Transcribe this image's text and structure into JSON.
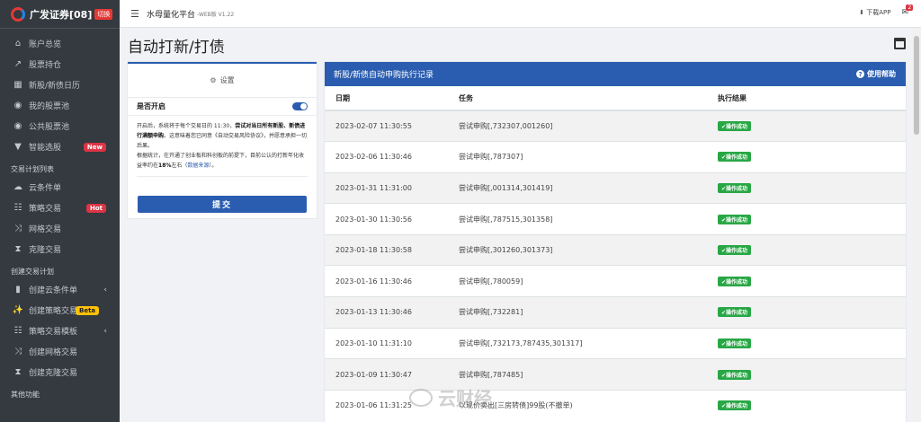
{
  "sidebar": {
    "brand": "广发证券[08]",
    "switch_label": "切换",
    "items_top": [
      {
        "label": "账户总览",
        "icon": "home-icon"
      },
      {
        "label": "股票持仓",
        "icon": "chart-line-icon"
      },
      {
        "label": "新股/新债日历",
        "icon": "calendar-icon"
      },
      {
        "label": "我的股票池",
        "icon": "coins-icon"
      },
      {
        "label": "公共股票池",
        "icon": "coins-icon"
      },
      {
        "label": "智能选股",
        "icon": "filter-icon",
        "tag": "New"
      }
    ],
    "section1": "交易计划列表",
    "items_plan": [
      {
        "label": "云条件单",
        "icon": "cloud-icon"
      },
      {
        "label": "策略交易",
        "icon": "sitemap-icon",
        "tag": "Hot"
      },
      {
        "label": "网格交易",
        "icon": "random-icon"
      },
      {
        "label": "克隆交易",
        "icon": "hourglass-icon"
      }
    ],
    "section2": "创建交易计划",
    "items_create": [
      {
        "label": "创建云条件单",
        "icon": "file-icon"
      },
      {
        "label": "创建策略交易",
        "icon": "magic-icon",
        "tag": "Beta"
      },
      {
        "label": "策略交易模板",
        "icon": "sitemap-icon"
      },
      {
        "label": "创建网格交易",
        "icon": "random-icon"
      },
      {
        "label": "创建克隆交易",
        "icon": "hourglass-icon"
      }
    ],
    "section3": "其他功能"
  },
  "topbar": {
    "title": "水母量化平台",
    "version": "-WEB版 V1.22",
    "download": "下载APP",
    "msg_count": "2"
  },
  "page": {
    "title": "自动打新/打债"
  },
  "settings": {
    "header": "设置",
    "toggle_label": "是否开启",
    "toggle_on": true,
    "desc_1a": "开启后，系统将于每个交易日的 11:30，",
    "desc_1b": "尝试对当日所有新股、新债进行满额申购",
    "desc_1c": "。这意味着您已同意《自动交易风险协议》，并愿意承担一切后果。",
    "desc_2a": "根据统计，在开通了创业板和科创板的前提下，目前公认的打新年化收益率约在",
    "desc_2b": "18%",
    "desc_2c": "左右（",
    "desc_2link": "数据来源",
    "desc_2d": "）。",
    "submit": "提交"
  },
  "records": {
    "header": "新股/新债自动申购执行记录",
    "help": "使用帮助",
    "columns": [
      "日期",
      "任务",
      "执行结果"
    ],
    "rows": [
      {
        "date": "2023-02-07 11:30:55",
        "task": "尝试申购[,732307,001260]",
        "result": "操作成功"
      },
      {
        "date": "2023-02-06 11:30:46",
        "task": "尝试申购[,787307]",
        "result": "操作成功"
      },
      {
        "date": "2023-01-31 11:31:00",
        "task": "尝试申购[,001314,301419]",
        "result": "操作成功"
      },
      {
        "date": "2023-01-30 11:30:56",
        "task": "尝试申购[,787515,301358]",
        "result": "操作成功"
      },
      {
        "date": "2023-01-18 11:30:58",
        "task": "尝试申购[,301260,301373]",
        "result": "操作成功"
      },
      {
        "date": "2023-01-16 11:30:46",
        "task": "尝试申购[,780059]",
        "result": "操作成功"
      },
      {
        "date": "2023-01-13 11:30:46",
        "task": "尝试申购[,732281]",
        "result": "操作成功"
      },
      {
        "date": "2023-01-10 11:31:10",
        "task": "尝试申购[,732173,787435,301317]",
        "result": "操作成功"
      },
      {
        "date": "2023-01-09 11:30:47",
        "task": "尝试申购[,787485]",
        "result": "操作成功"
      },
      {
        "date": "2023-01-06 11:31:25",
        "task": "以现价卖出[三房转债]99股(不撤单)",
        "result": "操作成功"
      }
    ]
  },
  "watermark": "云财经",
  "colors": {
    "primary": "#2a5db0",
    "sidebar_bg": "#343a40",
    "success": "#28a745",
    "danger": "#dc3545"
  }
}
